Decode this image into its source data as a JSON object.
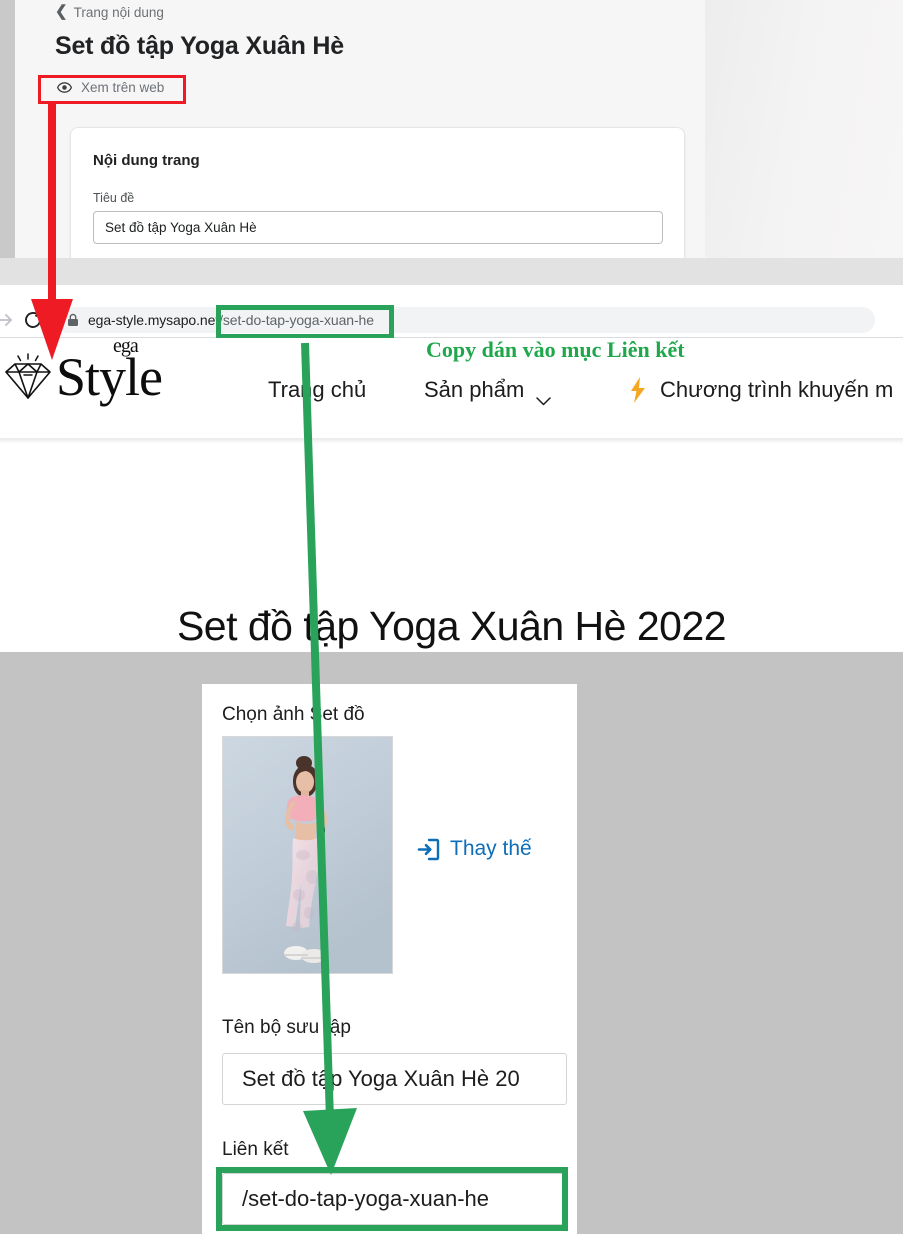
{
  "admin": {
    "breadcrumb": "Trang nội dung",
    "page_title": "Set đồ tập Yoga Xuân Hè",
    "view_on_web": "Xem trên web",
    "card": {
      "section_title": "Nội dung trang",
      "field_label": "Tiêu đề",
      "field_value": "Set đồ tập Yoga Xuân Hè"
    }
  },
  "browser": {
    "url_domain": "ega-style.mysapo.net",
    "url_path": "/set-do-tap-yoga-xuan-he",
    "reload_icon": "reload-icon",
    "lock_icon": "lock-icon",
    "forward_icon": "forward-arrow-icon"
  },
  "storefront": {
    "logo_word": "Style",
    "logo_sup": "ega",
    "nav": [
      {
        "label": "Trang chủ",
        "has_caret": false,
        "has_bolt": false
      },
      {
        "label": "Sản phẩm",
        "has_caret": true,
        "has_bolt": false
      },
      {
        "label": "Chương trình khuyến m",
        "has_caret": false,
        "has_bolt": true
      }
    ],
    "page_heading": "Set đồ tập Yoga Xuân Hè 2022",
    "card": {
      "image_label": "Chọn ảnh Set đồ",
      "replace_label": "Thay thế",
      "name_label": "Tên bộ sưu tập",
      "name_value": "Set đồ tập Yoga Xuân Hè 20",
      "link_label": "Liên kết",
      "link_value": "/set-do-tap-yoga-xuan-he"
    }
  },
  "annotations": {
    "copy_note": "Copy dán vào mục Liên kết",
    "red_color": "#ee1b24",
    "green_color": "#2aa35a"
  }
}
